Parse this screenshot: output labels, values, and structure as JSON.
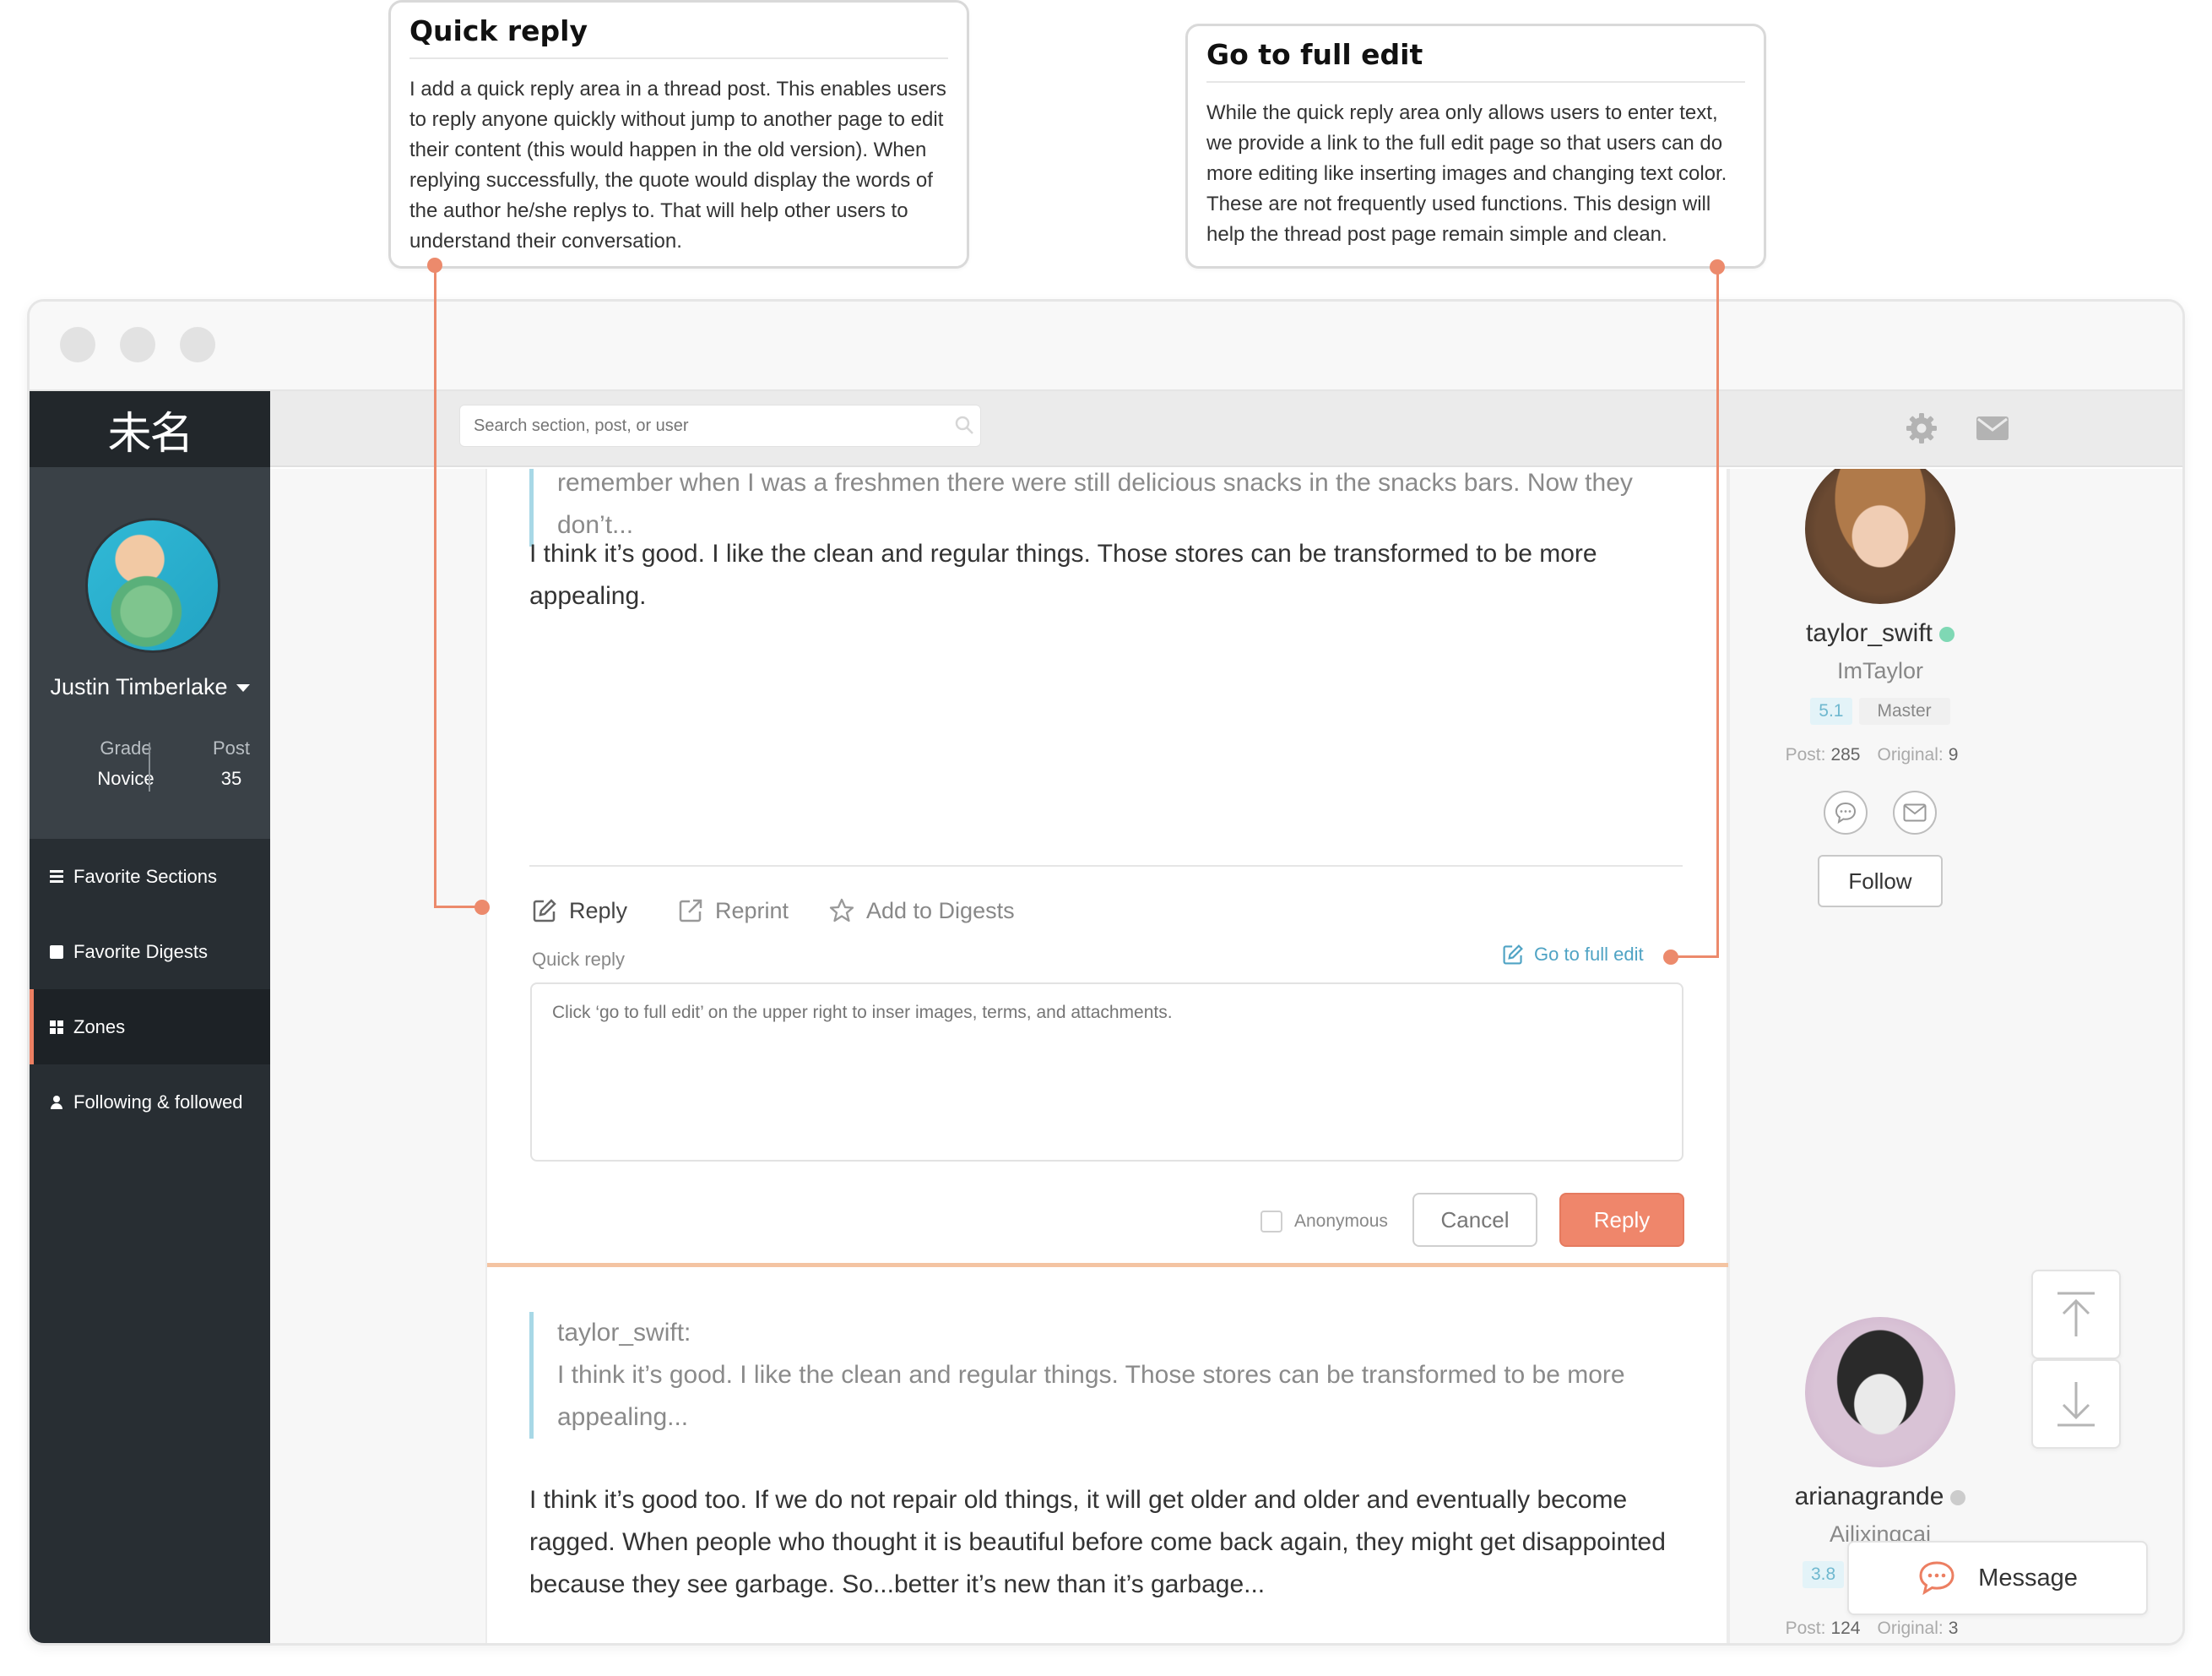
{
  "annotations": {
    "quick_reply": {
      "title": "Quick reply",
      "body": "I add a quick reply area in a thread post. This enables users to reply anyone quickly without jump to another page to edit their content (this would happen in the old version). When replying successfully, the quote would display the words of the author he/she replys to. That will help other users to understand their conversation."
    },
    "full_edit": {
      "title": "Go to full edit",
      "body": "While the quick reply area only allows users to enter text, we provide a link to the full edit page so that users can do more editing like inserting images and changing text color. These are not frequently used functions. This design will help the thread post page remain simple and clean."
    }
  },
  "colors": {
    "accent": "#ec8a6c",
    "sidebar": "#282e33",
    "link": "#4fa3c4",
    "quote_border": "#a8d8e6",
    "online": "#7fd8b4",
    "offline": "#cccccc"
  },
  "sidebar": {
    "logo": "未名",
    "user": {
      "name": "Justin Timberlake",
      "grade_label": "Grade",
      "grade_value": "Novice",
      "post_label": "Post",
      "post_value": "35"
    },
    "items": [
      {
        "label": "Favorite Sections",
        "icon": "list-icon"
      },
      {
        "label": "Favorite Digests",
        "icon": "book-icon"
      },
      {
        "label": "Zones",
        "icon": "grid-icon",
        "active": true
      },
      {
        "label": "Following & followed",
        "icon": "user-icon"
      }
    ]
  },
  "topbar": {
    "search_placeholder": "Search section, post, or user",
    "icons": [
      "search-icon",
      "gear-icon",
      "mail-icon"
    ]
  },
  "post1": {
    "quote_lines": [
      "remember when I was a freshmen there were still delicious snacks in the snacks bars. Now they",
      "don’t..."
    ],
    "text": "I think it’s good. I like the clean and regular things. Those stores can be transformed to be more appealing.",
    "actions": {
      "reply": "Reply",
      "reprint": "Reprint",
      "digest": "Add to Digests"
    },
    "quick_reply_label": "Quick reply",
    "full_edit_label": "Go to full edit",
    "reply_placeholder": "Click ‘go to full edit’ on the upper right to inser images, terms, and attachments.",
    "anonymous_label": "Anonymous",
    "cancel_label": "Cancel",
    "reply_label": "Reply"
  },
  "author1": {
    "name": "taylor_swift",
    "online": true,
    "nick": "ImTaylor",
    "grade": "5.1",
    "title": "Master",
    "post_label": "Post:",
    "post_value": "285",
    "original_label": "Original:",
    "original_value": "9",
    "follow_label": "Follow"
  },
  "post2": {
    "quote_author": "taylor_swift:",
    "quote_lines": [
      "I think it’s good. I like the clean and regular things. Those stores can be transformed to be more",
      "appealing..."
    ],
    "text": "I think it’s good too. If we do not repair old things, it will get older and older and eventually become ragged. When people who thought it is beautiful before come back again, they might get disappointed because they see garbage. So...better it’s new than it’s garbage..."
  },
  "author2": {
    "name": "arianagrande",
    "online": false,
    "nick": "Ailixingcai",
    "grade": "3.8",
    "post_label": "Post:",
    "post_value": "124",
    "original_label": "Original:",
    "original_value": "3"
  },
  "floating": {
    "message_label": "Message"
  }
}
